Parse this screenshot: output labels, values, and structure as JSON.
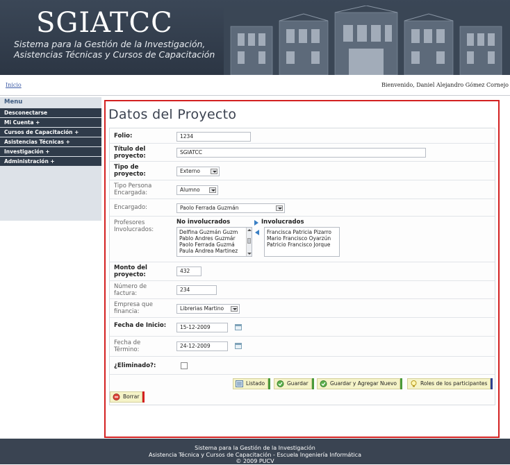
{
  "header": {
    "logo": "SGIATCC",
    "subtitle_line1": "Sistema para la Gestión de la Investigación,",
    "subtitle_line2": "Asistencias Técnicas y Cursos de Capacitación"
  },
  "topbar": {
    "home_link": "Inicio",
    "welcome": "Bienvenido, Daniel Alejandro Gómez Cornejo"
  },
  "sidebar": {
    "title": "Menu",
    "items": [
      {
        "label": "Desconectarse"
      },
      {
        "label": "Mi Cuenta +"
      },
      {
        "label": "Cursos de Capacitación +"
      },
      {
        "label": "Asistencias Técnicas +"
      },
      {
        "label": "Investigación +"
      },
      {
        "label": "Administración +"
      }
    ]
  },
  "form": {
    "title": "Datos del Proyecto",
    "folio": {
      "label": "Folio:",
      "value": "1234"
    },
    "titulo": {
      "label1": "Título del",
      "label2": "proyecto:",
      "value": "SGIATCC"
    },
    "tipo": {
      "label1": "Tipo de",
      "label2": "proyecto:",
      "value": "Externo"
    },
    "tipo_persona": {
      "label1": "Tipo Persona",
      "label2": "Encargada:",
      "value": "Alumno"
    },
    "encargado": {
      "label": "Encargado:",
      "value": "Paolo Ferrada Guzmán"
    },
    "profesores": {
      "label1": "Profesores",
      "label2": "Involucrados:",
      "not_involved_header": "No involucrados",
      "involved_header": "Involucrados",
      "not_involved": [
        "Delfina Guzmán Guzm",
        "Pablo Andres Guzmár",
        "Paolo Ferrada Guzmá",
        "Paula Andrea Martinez"
      ],
      "involved": [
        "Francisca Patricia Pizarro",
        "Mario Francisco Oyarzún",
        "Patricio Francisco Jorque"
      ]
    },
    "monto": {
      "label1": "Monto del",
      "label2": "proyecto:",
      "value": "432"
    },
    "factura": {
      "label1": "Número de",
      "label2": "factura:",
      "value": "234"
    },
    "empresa": {
      "label1": "Empresa que",
      "label2": "financia:",
      "value": "Librerias Martino"
    },
    "fecha_inicio": {
      "label": "Fecha de Inicio:",
      "value": "15-12-2009"
    },
    "fecha_termino": {
      "label1": "Fecha de",
      "label2": "Término:",
      "value": "24-12-2009"
    },
    "eliminado": {
      "label": "¿Eliminado?:"
    }
  },
  "buttons": {
    "listado": "Listado",
    "guardar": "Guardar",
    "guardar_nuevo": "Guardar y Agregar Nuevo",
    "roles": "Roles de los participantes",
    "borrar": "Borrar"
  },
  "footer": {
    "line1": "Sistema para la Gestión de la Investigación",
    "line2": "Asistencia Técnica y Cursos de Capacitación - Escuela Ingeniería Informática",
    "line3": "© 2009 PUCV"
  },
  "colors": {
    "header_bg": "#2f3a48",
    "sidebar_item_bg": "#2f3b4a",
    "highlight_border": "#d32020",
    "button_bg": "#f5f3c8"
  }
}
